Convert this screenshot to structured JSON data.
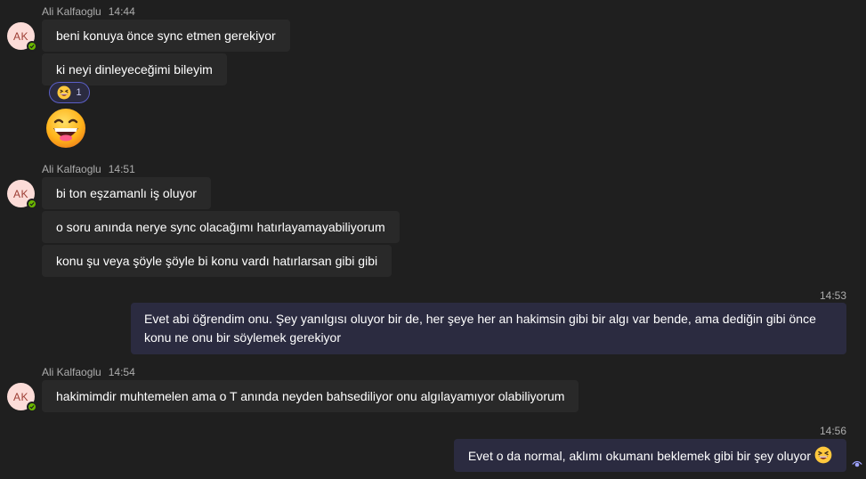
{
  "messages": [
    {
      "sender": "Ali Kalfaoglu",
      "initials": "AK",
      "time": "14:44",
      "lines": [
        "beni konuya önce sync etmen gerekiyor",
        "ki neyi dinleyeceğimi bileyim"
      ],
      "reaction": {
        "emoji": "grinning-squinting-face",
        "count": "1"
      },
      "sticker": "grinning-face-with-big-eyes"
    },
    {
      "sender": "Ali Kalfaoglu",
      "initials": "AK",
      "time": "14:51",
      "lines": [
        "bi ton eşzamanlı iş oluyor",
        "o soru anında nerye sync olacağımı hatırlayamayabiliyorum",
        "konu şu veya şöyle şöyle bi konu vardı hatırlarsan gibi gibi"
      ]
    },
    {
      "self": true,
      "time": "14:53",
      "line1": "Evet abi öğrendim onu. Şey yanılgısı oluyor bir de, her şeye her an hakimsin gibi bir algı var bende, ama dediğin gibi önce",
      "line2": "konu ne onu bir söylemek gerekiyor"
    },
    {
      "sender": "Ali Kalfaoglu",
      "initials": "AK",
      "time": "14:54",
      "lines": [
        "hakimimdir muhtemelen ama o T anında neyden bahsediliyor onu algılayamıyor olabiliyorum"
      ]
    },
    {
      "self": true,
      "time": "14:56",
      "line1": "Evet o da normal, aklımı okumanı beklemek gibi bir şey oluyor",
      "emoji": "grinning-squinting-face",
      "status": "read-eye-icon"
    }
  ],
  "colors": {
    "background": "#1f1f1f",
    "other_bubble": "#292929",
    "self_bubble": "#2b2b40",
    "presence_available": "#6bb700",
    "reaction_border": "#5b5fc7"
  }
}
